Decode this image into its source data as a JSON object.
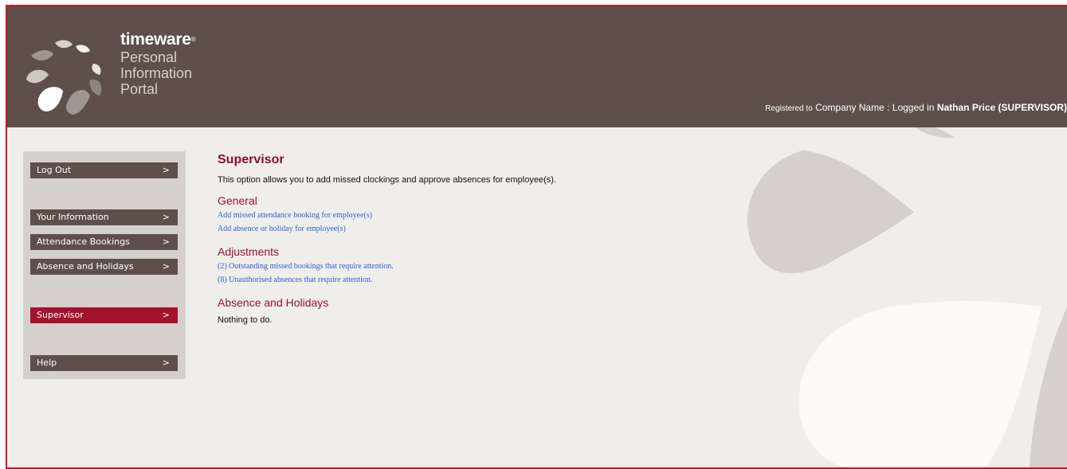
{
  "brand": {
    "name": "timeware",
    "mark": "®",
    "line1": "Personal",
    "line2": "Information",
    "line3": "Portal"
  },
  "registration": {
    "prefix": "Registered to",
    "company": "Company Name",
    "separator": " : Logged in ",
    "user": "Nathan Price (SUPERVISOR)"
  },
  "sidebar": {
    "items": [
      {
        "label": "Log Out",
        "arrow": ">"
      },
      {
        "label": "Your Information",
        "arrow": ">"
      },
      {
        "label": "Attendance Bookings",
        "arrow": ">"
      },
      {
        "label": "Absence and Holidays",
        "arrow": ">"
      },
      {
        "label": "Supervisor",
        "arrow": ">",
        "active": true
      },
      {
        "label": "Help",
        "arrow": ">"
      }
    ]
  },
  "main": {
    "title": "Supervisor",
    "intro": "This option allows you to add missed clockings and approve absences for employee(s).",
    "general": {
      "heading": "General",
      "links": [
        "Add missed attendance booking for employee(s)",
        "Add absence or holiday for employee(s)"
      ]
    },
    "adjustments": {
      "heading": "Adjustments",
      "links": [
        "(2) Outstanding missed bookings that require attention.",
        "(8) Unauthorised absences that require attention."
      ]
    },
    "absence": {
      "heading": "Absence and Holidays",
      "text": "Nothing to do."
    }
  },
  "colors": {
    "header": "#5e4f4a",
    "accent": "#a3122f",
    "link": "#2a5fd0",
    "background": "#f0eeeb"
  }
}
